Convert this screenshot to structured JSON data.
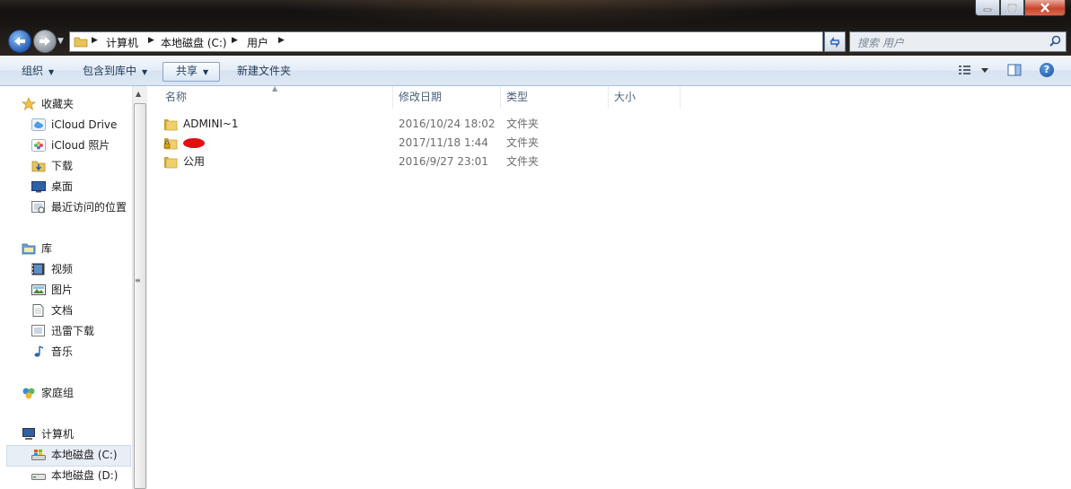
{
  "window": {
    "title_bar_controls": {
      "minimize": "minimize-icon",
      "maximize": "maximize-icon",
      "close": "close-icon"
    }
  },
  "address": {
    "crumbs": [
      "计算机",
      "本地磁盘 (C:)",
      "用户"
    ],
    "search_placeholder": "搜索 用户"
  },
  "toolbar": {
    "organize": "组织",
    "include_in_library": "包含到库中",
    "share": "共享",
    "new_folder": "新建文件夹"
  },
  "nav": {
    "favorites": {
      "label": "收藏夹",
      "items": [
        "iCloud Drive",
        "iCloud 照片",
        "下载",
        "桌面",
        "最近访问的位置"
      ]
    },
    "libraries": {
      "label": "库",
      "items": [
        "视频",
        "图片",
        "文档",
        "迅雷下载",
        "音乐"
      ]
    },
    "homegroup": {
      "label": "家庭组"
    },
    "computer": {
      "label": "计算机",
      "items": [
        "本地磁盘 (C:)",
        "本地磁盘 (D:)"
      ]
    }
  },
  "columns": {
    "name": "名称",
    "modified": "修改日期",
    "type": "类型",
    "size": "大小"
  },
  "files": [
    {
      "name": "ADMINI~1",
      "modified": "2016/10/24 18:02",
      "type": "文件夹",
      "icon": "folder-icon"
    },
    {
      "name": "",
      "modified": "2017/11/18 1:44",
      "type": "文件夹",
      "icon": "locked-folder-icon",
      "redacted": true
    },
    {
      "name": "公用",
      "modified": "2016/9/27 23:01",
      "type": "文件夹",
      "icon": "folder-icon"
    }
  ],
  "colors": {
    "accent": "#2a63b8",
    "command_text": "#1e395b",
    "redaction": "#e01010"
  }
}
